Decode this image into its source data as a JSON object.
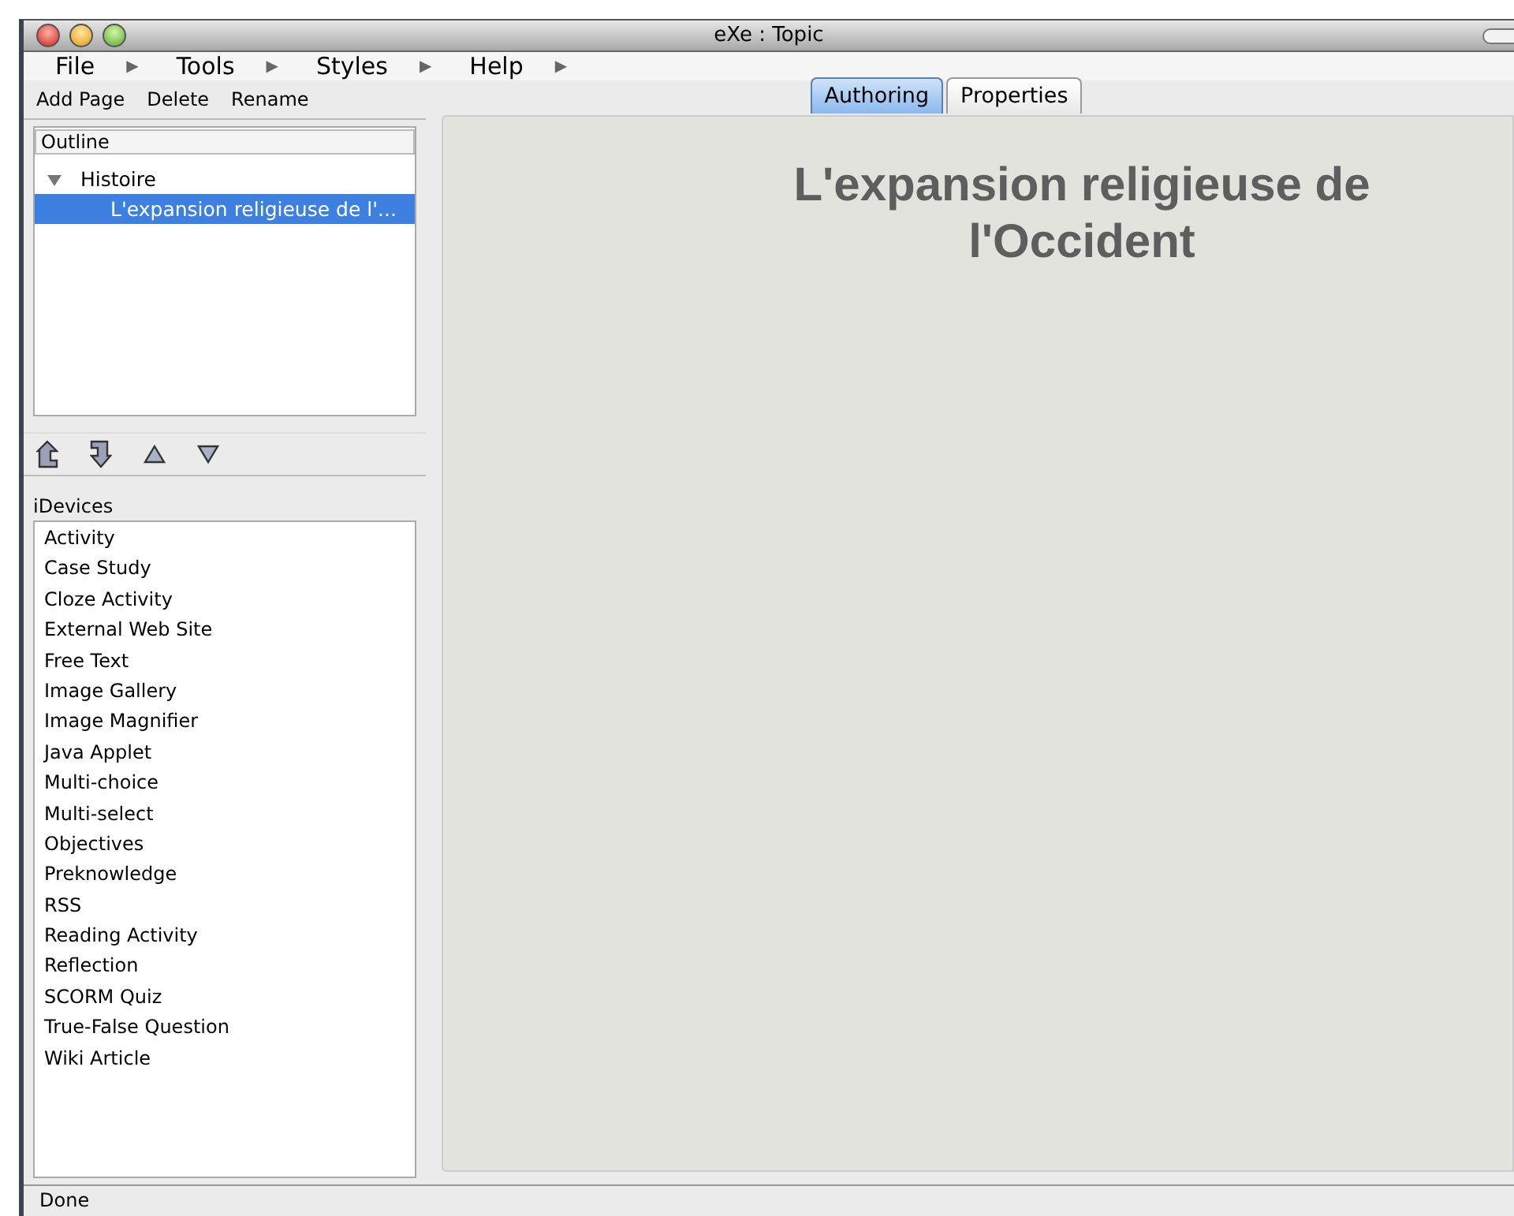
{
  "window": {
    "title": "eXe : Topic"
  },
  "menus": [
    {
      "label": "File",
      "arrow": "▶"
    },
    {
      "label": "Tools",
      "arrow": "▶"
    },
    {
      "label": "Styles",
      "arrow": "▶"
    },
    {
      "label": "Help",
      "arrow": "▶"
    }
  ],
  "toolbar": [
    "Add Page",
    "Delete",
    "Rename"
  ],
  "outline": {
    "header": "Outline",
    "tree": [
      {
        "label": "Histoire",
        "expanded": true,
        "selected": false,
        "children": [
          {
            "label": "L'expansion religieuse de l'...",
            "selected": true
          }
        ]
      }
    ]
  },
  "idevices": {
    "label": "iDevices",
    "items": [
      "Activity",
      "Case Study",
      "Cloze Activity",
      "External Web Site",
      "Free Text",
      "Image Gallery",
      "Image Magnifier",
      "Java Applet",
      "Multi-choice",
      "Multi-select",
      "Objectives",
      "Preknowledge",
      "RSS",
      "Reading Activity",
      "Reflection",
      "SCORM Quiz",
      "True-False Question",
      "Wiki Article"
    ]
  },
  "tabs": [
    {
      "label": "Authoring",
      "selected": true
    },
    {
      "label": "Properties",
      "selected": false
    }
  ],
  "content": {
    "heading": "L'expansion religieuse de l'Occident"
  },
  "status_bar": "Done"
}
